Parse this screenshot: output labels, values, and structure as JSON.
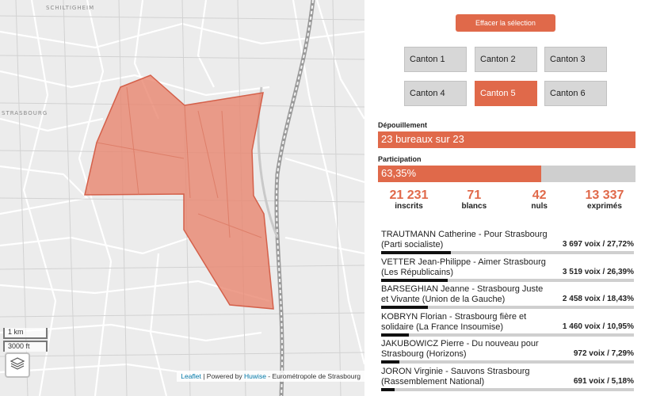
{
  "map": {
    "labels": {
      "top": "SCHILTIGHEIM",
      "left": "STRASBOURG"
    },
    "scale": {
      "metric": "1 km",
      "imperial": "3000 ft"
    },
    "layers_icon": "layers-icon",
    "attribution": {
      "leaflet": "Leaflet",
      "powered_by": "| Powered by",
      "huwise": "Huwise",
      "rest": "- Eurométropole de Strasbourg"
    },
    "colors": {
      "selected_area": "#e8866f",
      "selected_border": "#d4604a"
    }
  },
  "panel": {
    "clear_label": "Effacer la sélection",
    "cantons": [
      {
        "label": "Canton 1",
        "selected": false
      },
      {
        "label": "Canton 2",
        "selected": false
      },
      {
        "label": "Canton 3",
        "selected": false
      },
      {
        "label": "Canton 4",
        "selected": false
      },
      {
        "label": "Canton 5",
        "selected": true
      },
      {
        "label": "Canton 6",
        "selected": false
      }
    ],
    "depouillement": {
      "label": "Dépouillement",
      "text": "23 bureaux sur 23",
      "fraction": 1.0
    },
    "participation": {
      "label": "Participation",
      "text": "63,35%",
      "fraction": 0.6335
    },
    "stats": [
      {
        "value": "21 231",
        "label": "inscrits"
      },
      {
        "value": "71",
        "label": "blancs"
      },
      {
        "value": "42",
        "label": "nuls"
      },
      {
        "value": "13 337",
        "label": "exprimés"
      }
    ],
    "candidates": [
      {
        "name": "TRAUTMANN Catherine - Pour Strasbourg (Parti socialiste)",
        "votes": "3 697 voix /  27,72%",
        "pct": 27.72
      },
      {
        "name": "VETTER Jean-Philippe - Aimer Strasbourg (Les Républicains)",
        "votes": "3 519 voix /  26,39%",
        "pct": 26.39
      },
      {
        "name": "BARSEGHIAN Jeanne - Strasbourg Juste et Vivante (Union de la Gauche)",
        "votes": "2 458 voix /  18,43%",
        "pct": 18.43
      },
      {
        "name": "KOBRYN Florian - Strasbourg fière et solidaire (La France Insoumise)",
        "votes": "1 460 voix /  10,95%",
        "pct": 10.95
      },
      {
        "name": "JAKUBOWICZ Pierre - Du nouveau pour Strasbourg (Horizons)",
        "votes": "972 voix /  7,29%",
        "pct": 7.29
      },
      {
        "name": "JORON Virginie - Sauvons Strasbourg (Rassemblement National)",
        "votes": "691 voix /  5,18%",
        "pct": 5.18
      }
    ],
    "accent_color": "#e0694a"
  }
}
